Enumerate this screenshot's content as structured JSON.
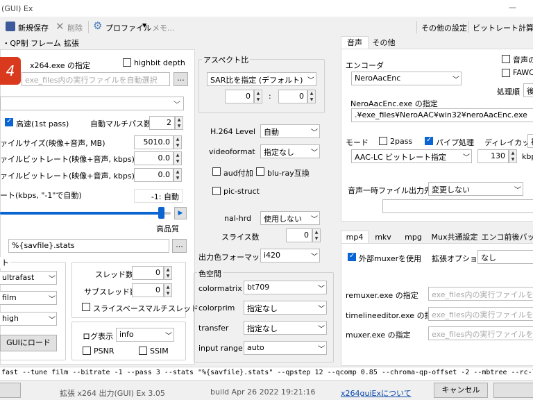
{
  "window": {
    "title": "(GUI) Ex",
    "minimize": "—"
  },
  "toolbar": {
    "save_new": "新規保存",
    "delete": "削除",
    "profile": "プロファイル",
    "memo": "メモ...",
    "other_settings": "その他の設定",
    "bitrate_calc": "ビットレート計算機"
  },
  "left_tabs": [
    "・QP制御",
    "フレーム",
    "拡張"
  ],
  "left": {
    "exe_label": "x264.exe の指定",
    "highbit_label": "highbit depth",
    "exe_placeholder": "exe_files内の実行ファイルを自動選択",
    "browse": "...",
    "fast_label": "高速(1st pass)",
    "auto_multipass_label": "自動マルチパス数",
    "auto_multipass_value": "2",
    "filesize_label": "ァイルサイズ(映像+音声, MB)",
    "filesize_value": "5010.0",
    "bitrate1_label": "ァイルビットレート(映像+音声, kbps)",
    "bitrate1_value": "0.0",
    "bitrate2_label": "ァイルビットレート(映像+音声, kbps)",
    "bitrate2_value": "0.0",
    "rate_label": "ート(kbps, \"-1\"で自動)",
    "rate_value": "-1: 自動",
    "quality_label": "高品質",
    "stats_value": "%{savfile}.stats",
    "preset_group_label": "ト",
    "preset": "ultrafast",
    "tune": "film",
    "profile": "high",
    "threads_label": "スレッド数",
    "threads_value": "0",
    "subthreads_label": "サブスレッド数",
    "subthreads_value": "0",
    "slice_mt_label": "スライスベースマルチスレッド",
    "gui_load": "GUIにロード",
    "log_label": "ログ表示",
    "log_value": "info",
    "psnr_label": "PSNR",
    "ssim_label": "SSIM"
  },
  "aspect": {
    "group_label": "アスペクト比",
    "sar_mode": "SAR比を指定 (デフォルト)",
    "sar_x": "0",
    "sar_sep": ":",
    "sar_y": "0"
  },
  "mid": {
    "h264_level_label": "H.264 Level",
    "h264_level": "自動",
    "videoformat_label": "videoformat",
    "videoformat": "指定なし",
    "aud_label": "aud付加",
    "bluray_label": "blu-ray互換",
    "picstruct_label": "pic-struct",
    "nalhrd_label": "nal-hrd",
    "nalhrd": "使用しない",
    "slices_label": "スライス数",
    "slices_value": "0",
    "outcsp_label": "出力色フォーマット",
    "outcsp": "i420",
    "colorspace_group": "色空間",
    "colormatrix_label": "colormatrix",
    "colormatrix": "bt709",
    "colorprim_label": "colorprim",
    "colorprim": "指定なし",
    "transfer_label": "transfer",
    "transfer": "指定なし",
    "inputrange_label": "input range",
    "inputrange": "auto"
  },
  "audio": {
    "tabs": [
      "音声",
      "その他"
    ],
    "encoder_label": "エンコーダ",
    "encoder": "NeroAacEnc",
    "audio_only_label": "音声の",
    "fawc_label": "FAWC",
    "order_label": "処理順",
    "order_value": "後",
    "exe_label": "NeroAacEnc.exe の指定",
    "exe_path": ".¥exe_files¥NeroAAC¥win32¥neroAacEnc.exe",
    "mode_label": "モード",
    "twopass_label": "2pass",
    "pipe_label": "パイプ処理",
    "delaycut_label": "ディレイカット",
    "delaycut_value": "補",
    "mode_value": "AAC-LC ビットレート指定",
    "bitrate_value": "130",
    "bitrate_unit": "kbp",
    "tempdir_label": "音声一時ファイル出力先",
    "tempdir_value": "変更しない"
  },
  "mux": {
    "tabs": [
      "mp4",
      "mkv",
      "mpg",
      "Mux共通設定",
      "エンコ前後バッチ処"
    ],
    "external_label": "外部muxerを使用",
    "ext_option_label": "拡張オプション",
    "ext_option_value": "なし",
    "remuxer_label": "remuxer.exe の指定",
    "timeline_label": "timelineeditor.exe の指定",
    "muxer_label": "muxer.exe の指定",
    "placeholder": "exe_files内の実行ファイルを自動選"
  },
  "cmdline": "fast --tune film --bitrate -1 --pass 3 --stats \"%{savfile}.stats\" --qpstep 12 --qcomp 0.85 --chroma-qp-offset -2 --mbtree --rc-lookahead 40 --aq-mode 1",
  "status": {
    "product": "拡張 x264 出力(GUI) Ex 3.05",
    "build": "build Apr 26 2022 19:21:16",
    "about": "x264guiExについて",
    "cancel": "キャンセル"
  },
  "colors": {
    "accent": "#0a64d2",
    "link": "#0645ad"
  }
}
